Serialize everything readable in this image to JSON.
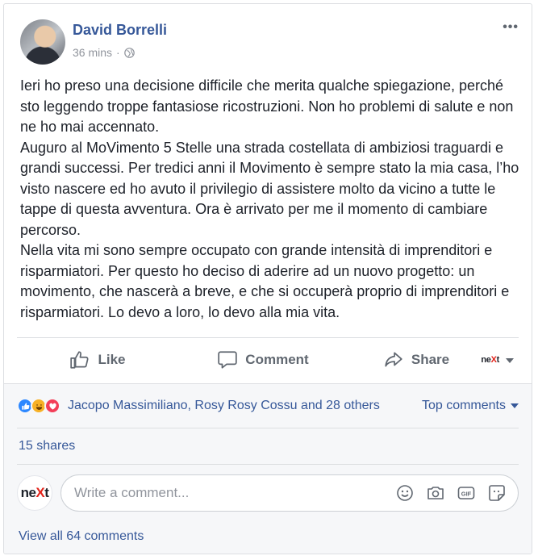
{
  "post": {
    "author": "David Borrelli",
    "time": "36 mins",
    "separator": "·",
    "more_label": "•••",
    "paragraphs": [
      "Ieri ho preso una decisione difficile che merita qualche spiegazione, perché sto leggendo troppe fantasiose ricostruzioni. Non ho problemi di salute e non ne ho mai accennato.",
      "Auguro al MoVimento 5 Stelle una strada costellata di ambiziosi traguardi e grandi successi. Per tredici anni il Movimento è sempre stato la mia casa, l’ho visto nascere ed ho avuto il privilegio di assistere molto da vicino a tutte le tappe di questa avventura. Ora è arrivato per me il momento di cambiare percorso.",
      "Nella vita mi sono sempre occupato con grande intensità di imprenditori e risparmiatori. Per questo ho deciso di aderire ad un nuovo progetto: un movimento, che nascerà a breve, e che si occuperà proprio di imprenditori e risparmiatori. Lo devo a loro, lo devo alla mia vita."
    ]
  },
  "actions": {
    "like": "Like",
    "comment": "Comment",
    "share": "Share",
    "page_logo": {
      "pre": "ne",
      "x": "X",
      "post": "t"
    }
  },
  "reactions": {
    "icons": [
      "like-reaction",
      "haha-reaction",
      "love-reaction"
    ],
    "names": "Jacopo Massimiliano, Rosy Rosy Cossu and 28 others",
    "sort_label": "Top comments"
  },
  "shares": "15 shares",
  "composer": {
    "avatar_logo": {
      "pre": "ne",
      "x": "X",
      "post": "t"
    },
    "placeholder": "Write a comment...",
    "icons": [
      "emoji-icon",
      "camera-icon",
      "gif-icon",
      "sticker-icon"
    ]
  },
  "view_all": "View all 64 comments",
  "colors": {
    "link": "#365899",
    "muted": "#90949c",
    "action": "#606770",
    "brand_red": "#e2231a",
    "like_blue": "#2d88ff"
  }
}
